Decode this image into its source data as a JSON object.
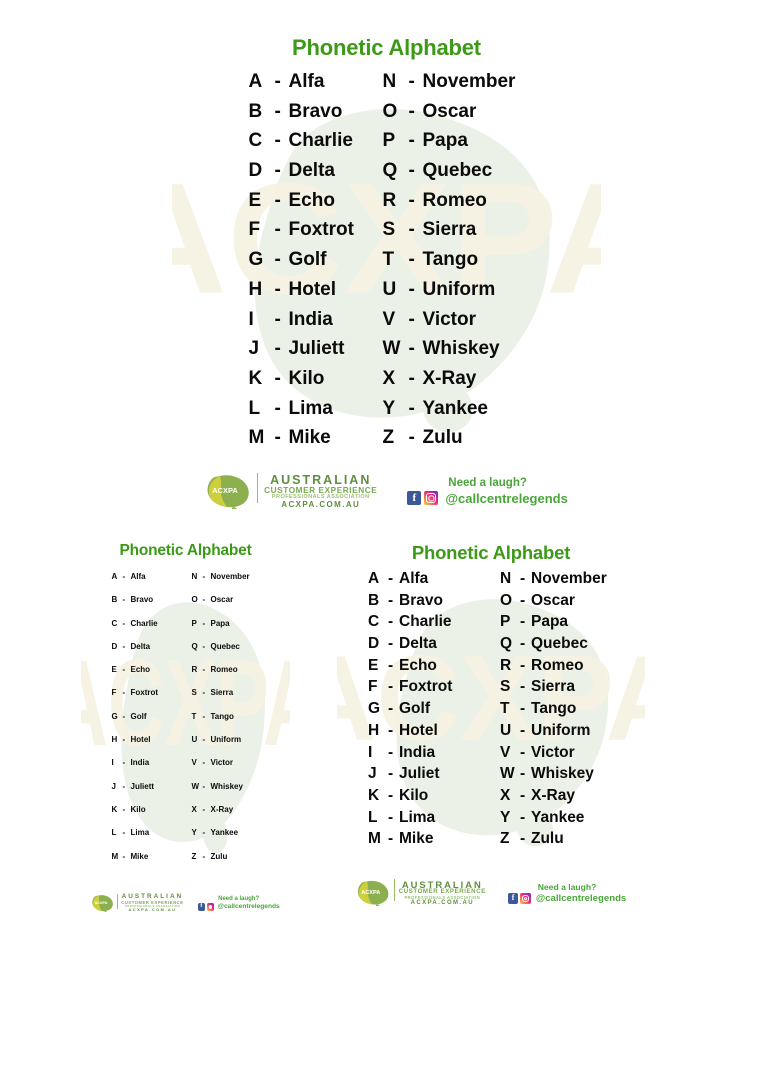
{
  "theme": {
    "title_green": "#3d9a17",
    "text_black": "#0b0b0b",
    "frame_black": "#0a0a0a",
    "paper_white": "#ffffff",
    "brand_green": "#5f8f3e",
    "brand_olive": "#c9c93f",
    "handle_green": "#4aa53a",
    "facebook_blue": "#3b5998",
    "watermark_cream": "#f5f2e2",
    "watermark_sage": "#e9efe3"
  },
  "shared": {
    "title": "Phonetic Alphabet",
    "dash": "-",
    "left_column": [
      {
        "letter": "A",
        "word": "Alfa"
      },
      {
        "letter": "B",
        "word": "Bravo"
      },
      {
        "letter": "C",
        "word": "Charlie"
      },
      {
        "letter": "D",
        "word": "Delta"
      },
      {
        "letter": "E",
        "word": "Echo"
      },
      {
        "letter": "F",
        "word": "Foxtrot"
      },
      {
        "letter": "G",
        "word": "Golf"
      },
      {
        "letter": "H",
        "word": "Hotel"
      },
      {
        "letter": "I",
        "word": "India"
      },
      {
        "letter": "J",
        "word": "Juliett"
      },
      {
        "letter": "K",
        "word": "Kilo"
      },
      {
        "letter": "L",
        "word": "Lima"
      },
      {
        "letter": "M",
        "word": "Mike"
      }
    ],
    "right_column": [
      {
        "letter": "N",
        "word": "November"
      },
      {
        "letter": "O",
        "word": "Oscar"
      },
      {
        "letter": "P",
        "word": "Papa"
      },
      {
        "letter": "Q",
        "word": "Quebec"
      },
      {
        "letter": "R",
        "word": "Romeo"
      },
      {
        "letter": "S",
        "word": "Sierra"
      },
      {
        "letter": "T",
        "word": "Tango"
      },
      {
        "letter": "U",
        "word": "Uniform"
      },
      {
        "letter": "V",
        "word": "Victor"
      },
      {
        "letter": "W",
        "word": "Whiskey"
      },
      {
        "letter": "X",
        "word": "X-Ray"
      },
      {
        "letter": "Y",
        "word": "Yankee"
      },
      {
        "letter": "Z",
        "word": "Zulu"
      }
    ],
    "footer": {
      "logo_mark_text": "ACXPA",
      "brand_line1": "AUSTRALIAN",
      "brand_line2": "CUSTOMER EXPERIENCE",
      "brand_line3": "PROFESSIONALS ASSOCIATION",
      "brand_line4": "ACXPA.COM.AU",
      "laugh_question": "Need a laugh?",
      "social_handle": "@callcentrelegends",
      "facebook_glyph": "f",
      "icons": [
        "facebook-icon",
        "instagram-icon"
      ]
    },
    "watermark_text": "ACXPA"
  },
  "posters": [
    {
      "id": "main",
      "name": "main-poster",
      "title": "Phonetic Alphabet",
      "juliet_variant": "Juliett"
    },
    {
      "id": "bottom-left",
      "name": "bottom-left-poster",
      "title": "Phonetic Alphabet",
      "juliet_variant": "Juliett"
    },
    {
      "id": "bottom-right",
      "name": "bottom-right-poster",
      "title": "Phonetic Alphabet",
      "juliet_variant": "Juliet"
    }
  ]
}
